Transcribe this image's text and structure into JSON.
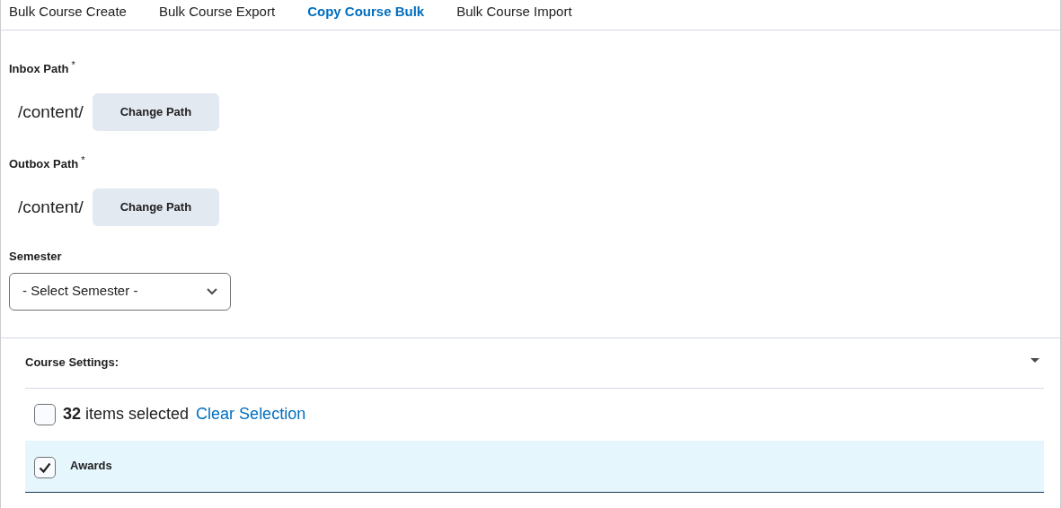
{
  "tabs": [
    {
      "label": "Bulk Course Create",
      "selected": false
    },
    {
      "label": "Bulk Course Export",
      "selected": false
    },
    {
      "label": "Copy Course Bulk",
      "selected": true
    },
    {
      "label": "Bulk Course Import",
      "selected": false
    }
  ],
  "paths": [
    {
      "label": "Inbox Path",
      "required_mark": "*",
      "value": "/content/",
      "button": "Change Path"
    },
    {
      "label": "Outbox Path",
      "required_mark": "*",
      "value": "/content/",
      "button": "Change Path"
    }
  ],
  "semester": {
    "label": "Semester",
    "value": "- Select Semester -"
  },
  "course_settings": {
    "title": "Course Settings:",
    "expanded": true,
    "select_all": {
      "checked": false,
      "summary": "**32** items selected",
      "action": "Clear Selection"
    },
    "items": [
      {
        "label": "Awards",
        "checked": true
      }
    ]
  }
}
